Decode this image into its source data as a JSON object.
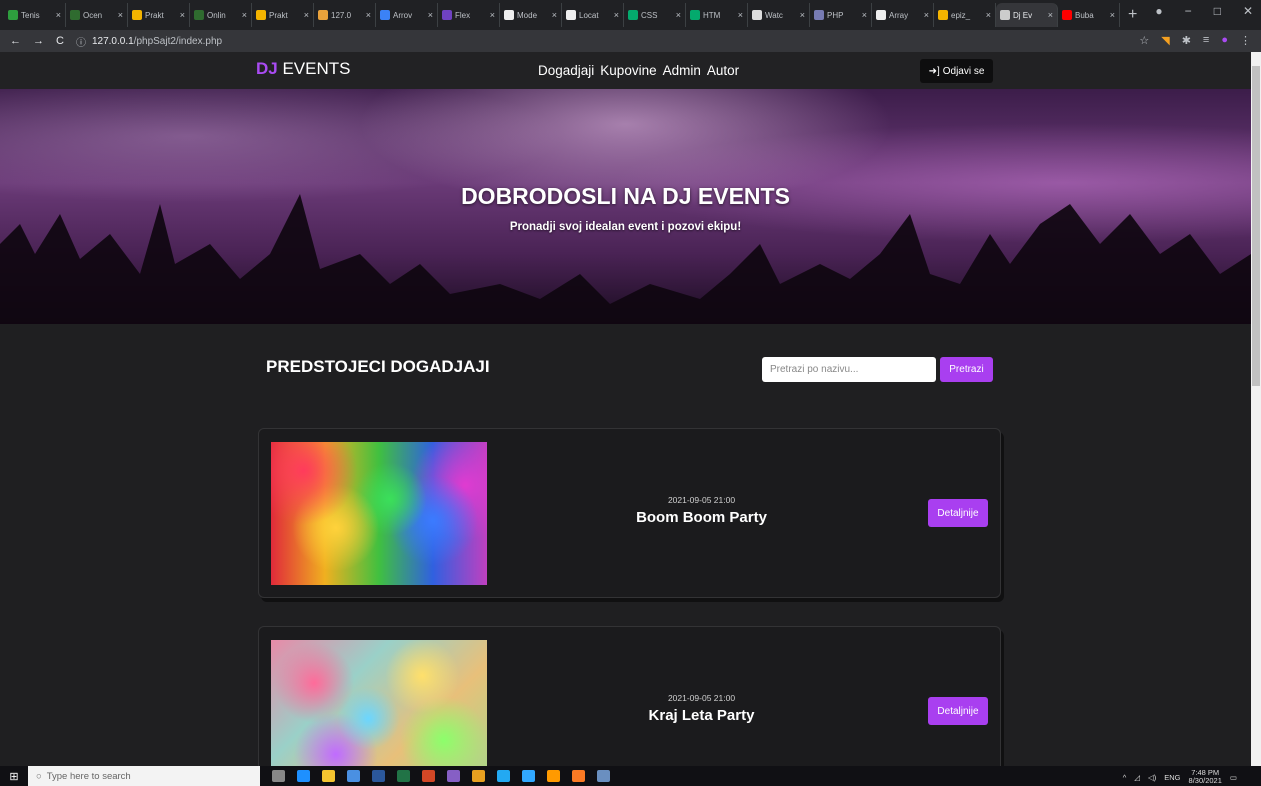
{
  "browser": {
    "tabs": [
      {
        "label": "Tenis",
        "color": "#2e9e3e"
      },
      {
        "label": "Ocen",
        "color": "#2f6b2f"
      },
      {
        "label": "Prakt",
        "color": "#f4b400"
      },
      {
        "label": "Onlin",
        "color": "#2f6b2f"
      },
      {
        "label": "Prakt",
        "color": "#f4b400"
      },
      {
        "label": "127.0",
        "color": "#e9a23b"
      },
      {
        "label": "Arrov",
        "color": "#3b82f6"
      },
      {
        "label": "Flex",
        "color": "#6f42c1"
      },
      {
        "label": "Mode",
        "color": "#eeeeee"
      },
      {
        "label": "Locat",
        "color": "#eeeeee"
      },
      {
        "label": "CSS",
        "color": "#04aa6d"
      },
      {
        "label": "HTM",
        "color": "#04aa6d"
      },
      {
        "label": "Watc",
        "color": "#dddddd"
      },
      {
        "label": "PHP",
        "color": "#777bb3"
      },
      {
        "label": "Array",
        "color": "#eeeeee"
      },
      {
        "label": "epiz_",
        "color": "#f4b400"
      },
      {
        "label": "Dj Ev",
        "color": "#cccccc",
        "active": true
      },
      {
        "label": "Buba",
        "color": "#ff0000"
      }
    ],
    "close_glyph": "×",
    "new_tab": "+",
    "url_host": "127.0.0.1",
    "url_path": "/phpSajt2/index.php"
  },
  "nav": {
    "brand_dj": "DJ",
    "brand_events": " EVENTS",
    "menu": [
      "Dogadjaji",
      "Kupovine",
      "Admin",
      "Autor"
    ],
    "logout_label": "Odjavi se"
  },
  "hero": {
    "title": "DOBRODOSLI NA DJ EVENTS",
    "subtitle": "Pronadji svoj idealan event i pozovi ekipu!"
  },
  "events_section": {
    "title": "PREDSTOJECI DOGADJAJI",
    "search_placeholder": "Pretrazi po nazivu...",
    "search_button": "Pretrazi"
  },
  "events": [
    {
      "date": "2021-09-05 21:00",
      "name": "Boom Boom Party",
      "button": "Detaljnije"
    },
    {
      "date": "2021-09-05 21:00",
      "name": "Kraj Leta Party",
      "button": "Detaljnije"
    }
  ],
  "taskbar": {
    "search_placeholder": "Type here to search",
    "lang": "ENG",
    "time": "7:48 PM",
    "date": "8/30/2021"
  }
}
